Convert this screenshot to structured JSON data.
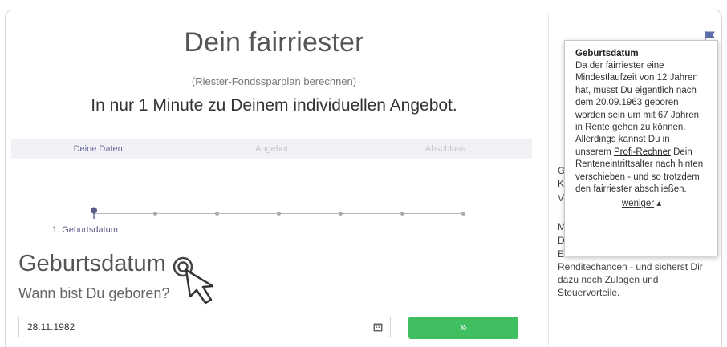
{
  "header": {
    "title": "Dein fairriester",
    "subtitle": "(Riester-Fondssparplan berechnen)",
    "headline": "In nur 1 Minute zu Deinem individuellen Angebot."
  },
  "tabs": [
    {
      "label": "Deine Daten",
      "active": true
    },
    {
      "label": "Angebot",
      "active": false
    },
    {
      "label": "Abschluss",
      "active": false
    }
  ],
  "stepper": {
    "current_label": "1. Geburtsdatum",
    "total_steps": 7,
    "current_step": 1
  },
  "question": {
    "title": "Geburtsdatum",
    "subtitle": "Wann bist Du geboren?"
  },
  "form": {
    "date_value": "28.11.1982",
    "next_label": "»"
  },
  "icons": {
    "calendar": "calendar-icon",
    "flag": "flag-icon",
    "cursor": "hand-pointer-cursor-icon",
    "location": "location-pin-icon"
  },
  "colors": {
    "accent": "#6a6a9a",
    "button": "#3fbf5f",
    "tabs_bg": "#f2f2f6",
    "flag": "#5b6ea8"
  },
  "sidebar": {
    "partial_letters": [
      "G",
      "K",
      "V",
      "M",
      "D",
      "E"
    ],
    "text_lines": [
      "Renditechancen - und sicherst Dir",
      "dazu noch Zulagen und",
      "Steuervorteile."
    ]
  },
  "tooltip": {
    "title": "Geburtsdatum",
    "body_1": "Da der fairriester eine Mindestlaufzeit von 12 Jahren hat, musst Du eigentlich nach dem 20.09.1963 geboren worden sein um mit 67 Jahren in Rente gehen zu können. Allerdings kannst Du in unserem ",
    "link": "Profi-Rechner",
    "body_2": " Dein Renteneintrittsalter nach hinten verschieben - und so trotzdem den fairriester abschließen.",
    "less_label": "weniger",
    "less_arrow": "▴"
  }
}
